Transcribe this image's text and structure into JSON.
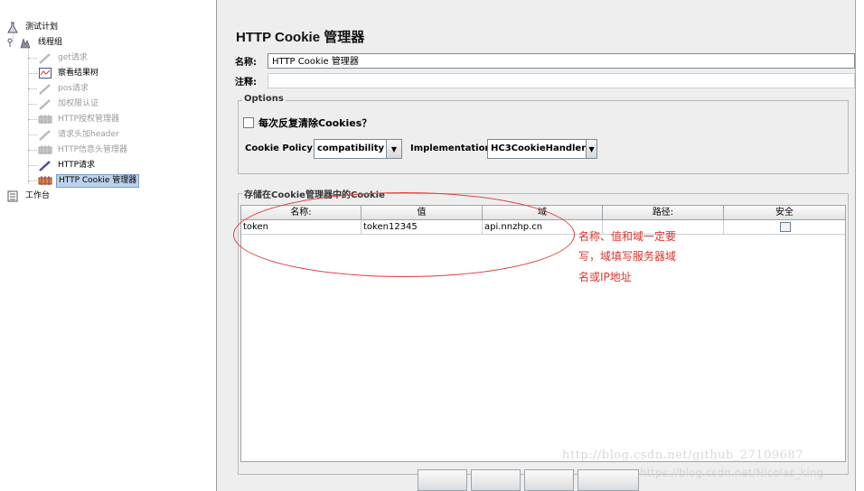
{
  "tree": {
    "items": [
      {
        "label": "测试计划"
      },
      {
        "label": "线程组"
      },
      {
        "label": "get请求"
      },
      {
        "label": "察看结果树"
      },
      {
        "label": "pos请求"
      },
      {
        "label": "加权限认证"
      },
      {
        "label": "HTTP授权管理器"
      },
      {
        "label": "请求头加header"
      },
      {
        "label": "HTTP信息头管理器"
      },
      {
        "label": "HTTP请求"
      },
      {
        "label": "HTTP Cookie 管理器"
      },
      {
        "label": "工作台"
      }
    ]
  },
  "panel": {
    "title": "HTTP Cookie 管理器",
    "name_label": "名称:",
    "name_value": "HTTP Cookie 管理器",
    "comment_label": "注释:",
    "comment_value": "",
    "options_title": "Options",
    "clear_each_label": "每次反复清除Cookies？",
    "clear_each_checked": false,
    "policy_label": "Cookie Policy:",
    "policy_value": "compatibility",
    "impl_label": "Implementation:",
    "impl_value": "HC3CookieHandler",
    "stored_title": "存储在Cookie管理器中的Cookie"
  },
  "table": {
    "columns": [
      "名称:",
      "值",
      "域",
      "路径:",
      "安全"
    ],
    "rows": [
      {
        "name": "token",
        "value": "token12345",
        "domain": "api.nnzhp.cn",
        "path": "",
        "secure": false
      }
    ]
  },
  "annotation": {
    "lines": [
      "名称、值和域一定要",
      "写，域填写服务器域",
      "名或IP地址"
    ],
    "color": "#e0332c"
  },
  "watermark": {
    "line1": "http://blog.csdn.net/github_27109687",
    "line2": "https://blog.csdn.net/Nicolas_king"
  }
}
